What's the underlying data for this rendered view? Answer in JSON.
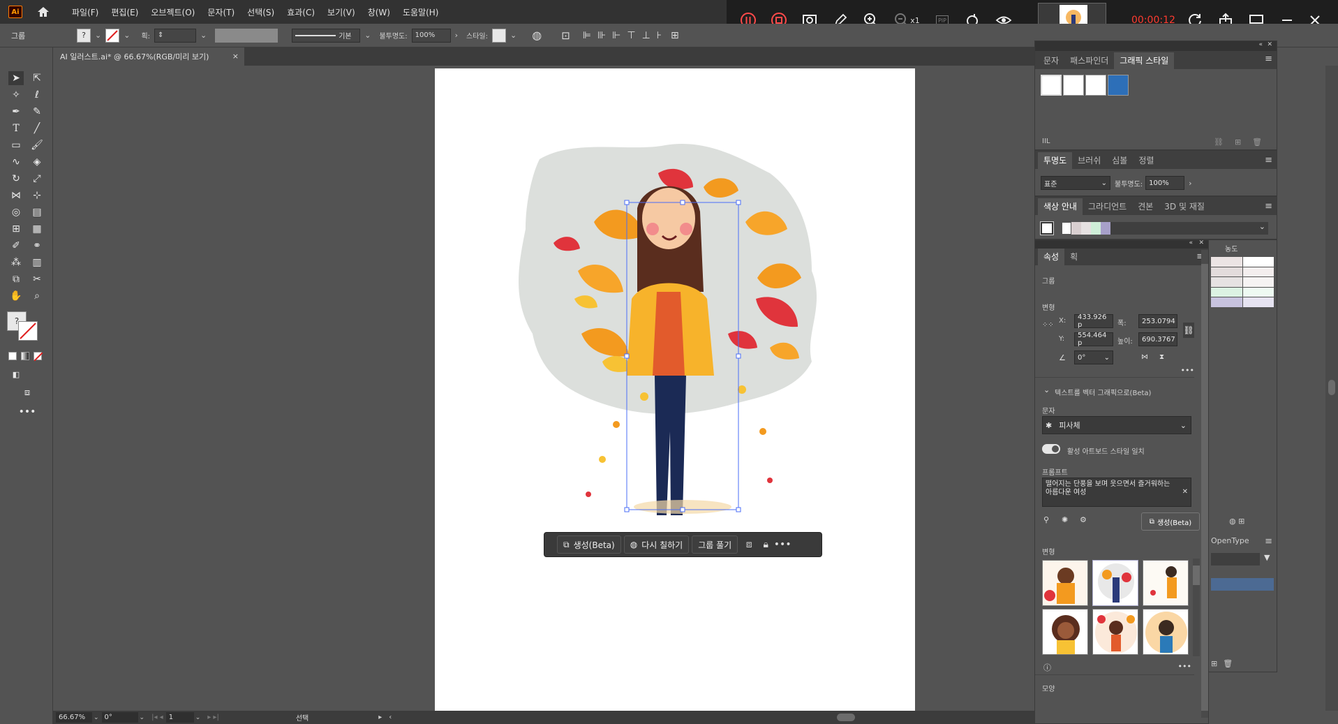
{
  "app": {
    "logo": "Ai",
    "home_icon": "home-icon"
  },
  "menu": [
    "파일(F)",
    "편집(E)",
    "오브젝트(O)",
    "문자(T)",
    "선택(S)",
    "효과(C)",
    "보기(V)",
    "창(W)",
    "도움말(H)"
  ],
  "recorder": {
    "zoom_label": "x1",
    "pip_label": "PIP",
    "time": "00:00:12"
  },
  "control": {
    "selection_label": "그룹",
    "stroke_label": "획:",
    "stroke_style": "기본",
    "opacity_label": "불투명도:",
    "opacity_value": "100%",
    "style_label": "스타일:"
  },
  "document": {
    "tab_title": "AI 일러스트.ai* @ 66.67%(RGB/미리 보기)",
    "close": "×"
  },
  "context_bar": {
    "generate": "생성(Beta)",
    "recolor": "다시 칠하기",
    "ungroup": "그룹 풀기",
    "more": "•••"
  },
  "status": {
    "zoom": "66.67%",
    "rotation": "0°",
    "page": "1",
    "tool": "선택"
  },
  "graphic_style_panel": {
    "tabs": [
      "문자",
      "패스파인더",
      "그래픽 스타일"
    ],
    "active": 2
  },
  "transparency_panel": {
    "tabs": [
      "투명도",
      "브러쉬",
      "심볼",
      "정렬"
    ],
    "blend_mode": "표준",
    "opacity_label": "불투명도:",
    "opacity_value": "100%"
  },
  "color_guide_panel": {
    "tabs": [
      "색상 안내",
      "그라디언트",
      "견본",
      "3D 및 재질"
    ]
  },
  "properties_panel": {
    "tabs": [
      "속성",
      "획"
    ],
    "section_group": "그룹",
    "section_transform": "변형",
    "x_label": "X:",
    "x_value": "433.926 p",
    "y_label": "Y:",
    "y_value": "554.464 p",
    "w_label": "폭:",
    "w_value": "253.0794",
    "h_label": "높이:",
    "h_value": "690.3767",
    "angle_value": "0°",
    "text_to_vector": "텍스트를 벡터 그래픽으로(Beta)",
    "subject_label": "문자",
    "subject_value": "피사체",
    "match_style": "활성 아트보드 스타일 일치",
    "prompt_label": "프롬프트",
    "prompt_text": "떨어지는 단풍을 보며 웃으면서 즐거워하는 아름다운 여성",
    "generate_btn": "생성(Beta)",
    "variations_label": "변형",
    "appearance_label": "모양"
  },
  "back_panel": {
    "density_label": "농도",
    "opentype_label": "OpenType"
  },
  "colors": {
    "accent_blue": "#1473e6",
    "selection_blue": "#4a6cf7",
    "recorder_red": "#ff3b30",
    "leaf_orange": "#f39a1f",
    "leaf_red": "#e0343c",
    "leaf_yellow": "#f7c234"
  }
}
